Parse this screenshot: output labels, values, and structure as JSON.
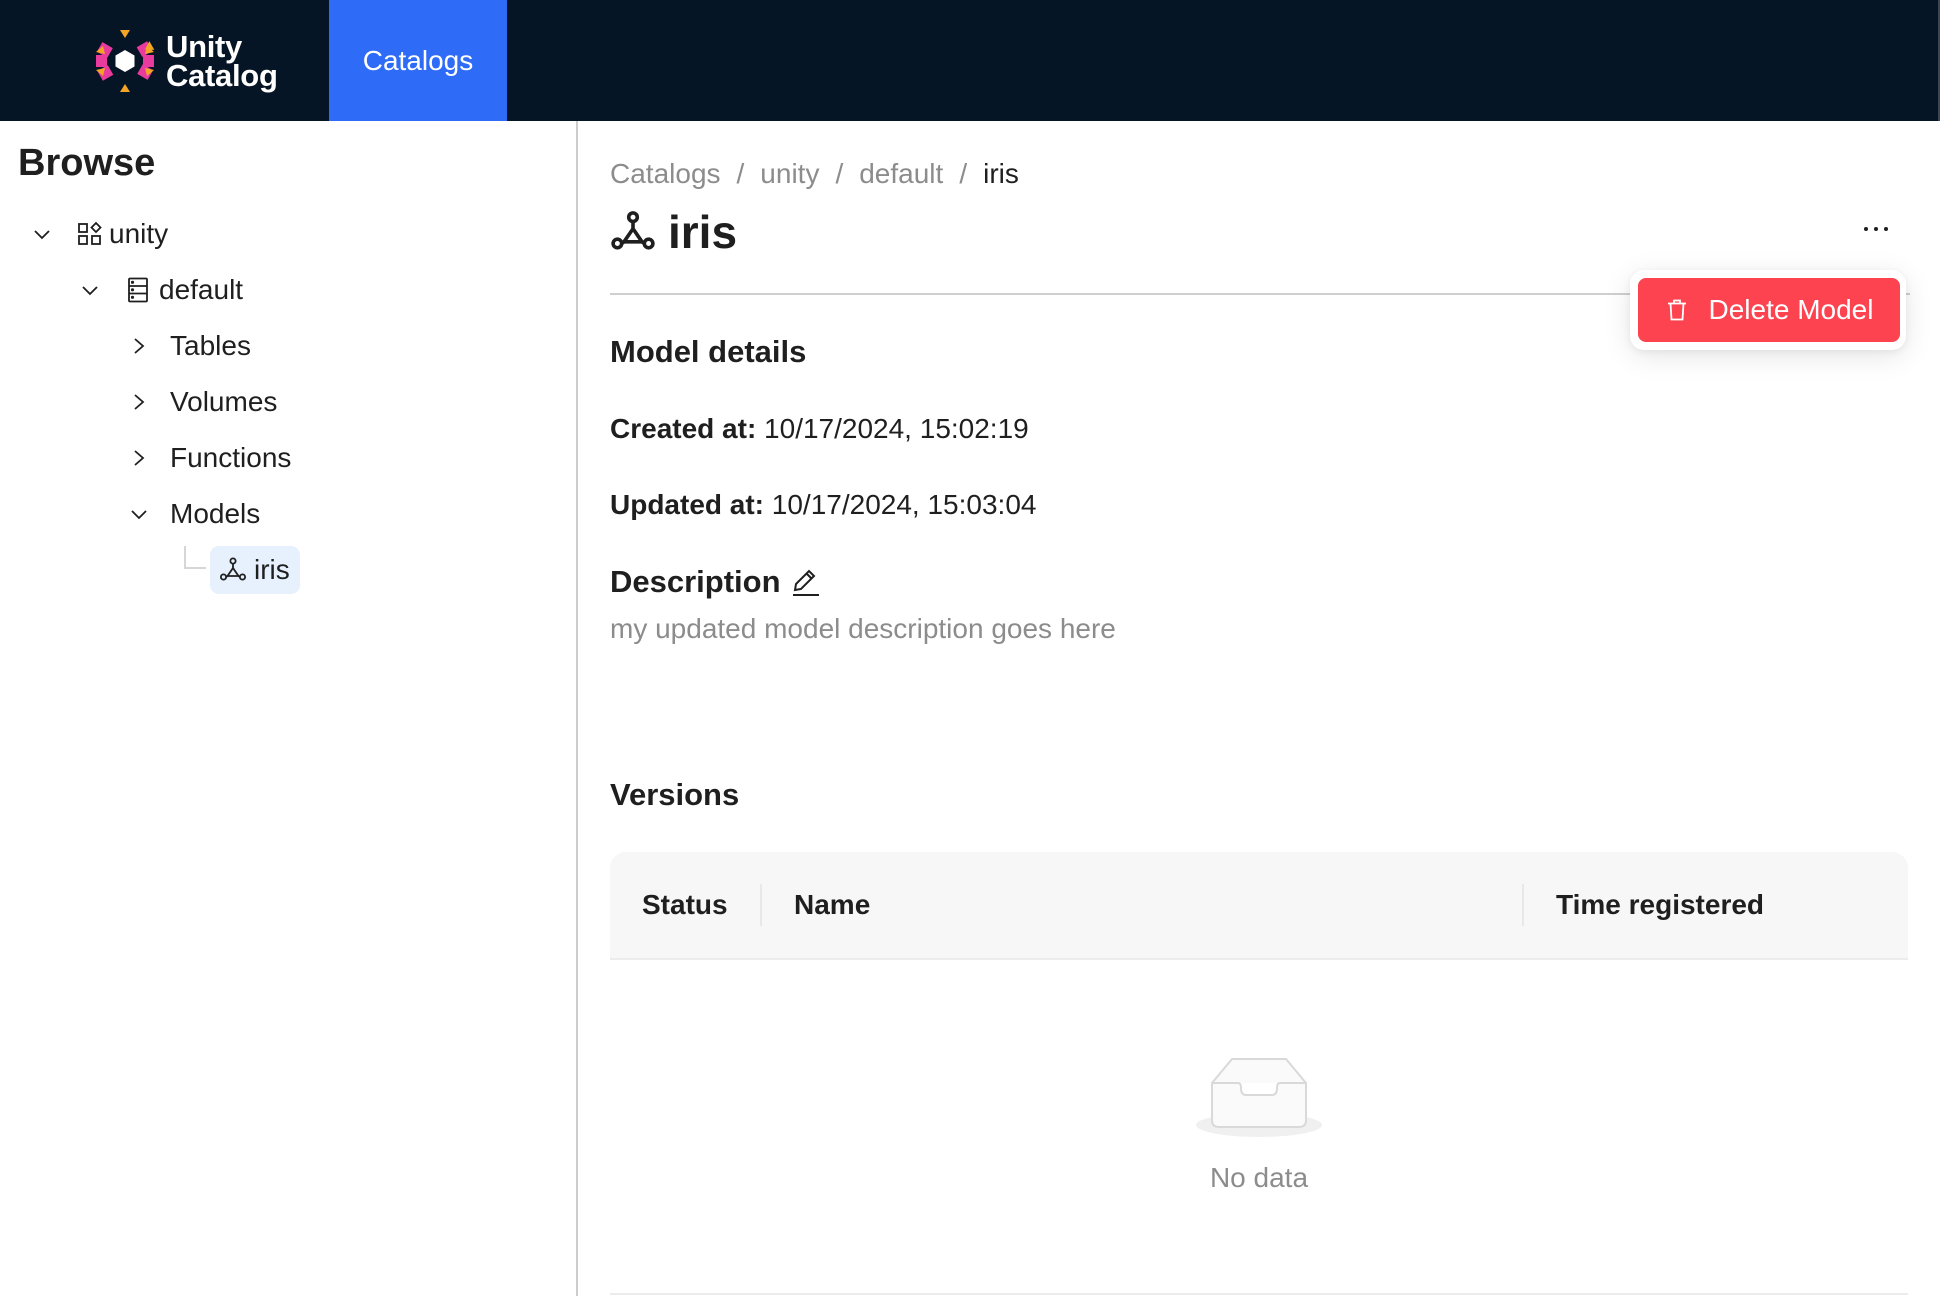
{
  "header": {
    "brand": {
      "line1": "Unity",
      "line2": "Catalog",
      "icon": "unity-catalog-logo"
    },
    "nav": [
      {
        "label": "Catalogs",
        "active": true
      }
    ],
    "colors": {
      "background": "#061525",
      "active_tab": "#2e6bf6",
      "logo_pink": "#e93b9e",
      "logo_yellow": "#f5a524"
    }
  },
  "sidebar": {
    "title": "Browse",
    "tree": {
      "catalog": {
        "label": "unity",
        "icon": "catalog-icon",
        "expanded": true
      },
      "schema": {
        "label": "default",
        "icon": "schema-icon",
        "expanded": true
      },
      "groups": [
        {
          "label": "Tables",
          "expanded": false
        },
        {
          "label": "Volumes",
          "expanded": false
        },
        {
          "label": "Functions",
          "expanded": false
        },
        {
          "label": "Models",
          "expanded": true
        }
      ],
      "selected": {
        "label": "iris",
        "icon": "model-icon"
      }
    }
  },
  "main": {
    "breadcrumb": [
      "Catalogs",
      "unity",
      "default",
      "iris"
    ],
    "breadcrumb_separator": "/",
    "title": "iris",
    "title_icon": "model-icon",
    "more_menu": {
      "icon": "ellipsis-icon",
      "items": [
        {
          "label": "Delete Model",
          "icon": "trash-icon",
          "color": "#fd434f"
        }
      ]
    },
    "details": {
      "heading": "Model details",
      "created_label": "Created at:",
      "created_value": "10/17/2024, 15:02:19",
      "updated_label": "Updated at:",
      "updated_value": "10/17/2024, 15:03:04"
    },
    "description": {
      "heading": "Description",
      "edit_icon": "pencil-icon",
      "text": "my updated model description goes here"
    },
    "versions": {
      "heading": "Versions",
      "columns": [
        "Status",
        "Name",
        "Time registered"
      ],
      "rows": [],
      "empty_text": "No data",
      "empty_icon": "empty-inbox-icon"
    }
  }
}
